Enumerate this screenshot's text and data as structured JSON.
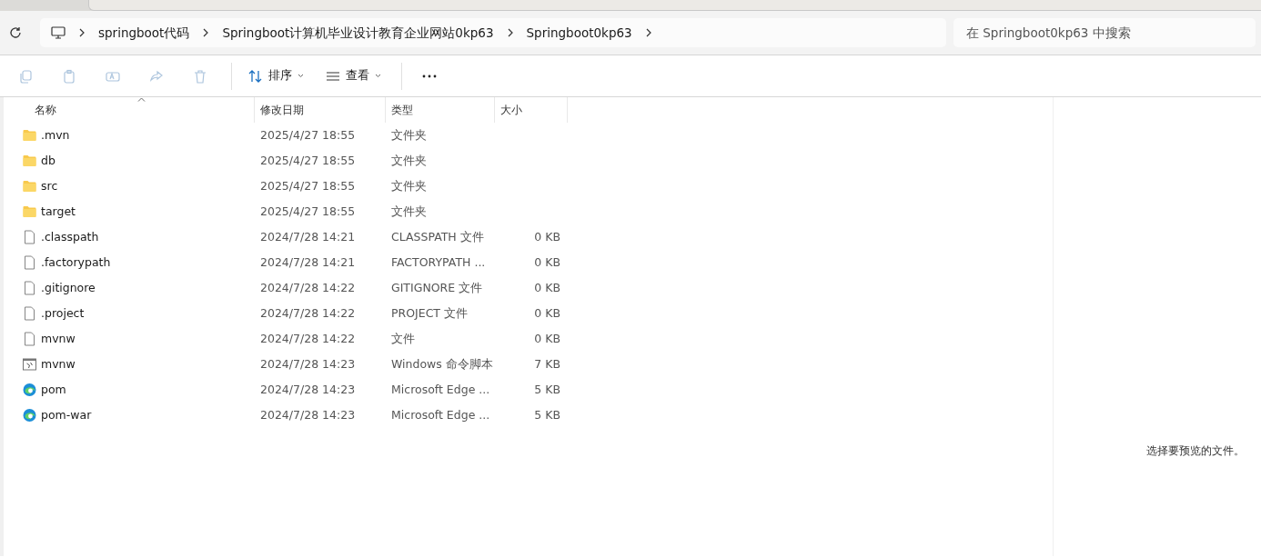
{
  "breadcrumb": [
    "springboot代码",
    "Springboot计算机毕业设计教育企业网站0kp63",
    "Springboot0kp63"
  ],
  "search": {
    "placeholder": "在 Springboot0kp63 中搜索"
  },
  "toolbar": [
    {
      "kind": "copy",
      "disabled": true
    },
    {
      "kind": "paste",
      "disabled": true
    },
    {
      "kind": "rename",
      "disabled": true
    },
    {
      "kind": "share",
      "disabled": true
    },
    {
      "kind": "delete",
      "disabled": true
    },
    {
      "kind": "sort",
      "label": "排序",
      "disabled": false
    },
    {
      "kind": "view",
      "label": "查看",
      "disabled": false
    },
    {
      "kind": "more",
      "disabled": false
    }
  ],
  "table": {
    "columns": [
      "名称",
      "修改日期",
      "类型",
      "大小"
    ],
    "rows": [
      {
        "kind": "folder",
        "name": ".mvn",
        "modified": "2025/4/27 18:55",
        "type": "文件夹"
      },
      {
        "kind": "folder",
        "name": "db",
        "modified": "2025/4/27 18:55",
        "type": "文件夹"
      },
      {
        "kind": "folder",
        "name": "src",
        "modified": "2025/4/27 18:55",
        "type": "文件夹"
      },
      {
        "kind": "folder",
        "name": "target",
        "modified": "2025/4/27 18:55",
        "type": "文件夹"
      },
      {
        "kind": "file",
        "name": ".classpath",
        "modified": "2024/7/28 14:21",
        "type": "CLASSPATH 文件",
        "size": "0 KB"
      },
      {
        "kind": "file",
        "name": ".factorypath",
        "modified": "2024/7/28 14:21",
        "type": "FACTORYPATH ...",
        "size": "0 KB"
      },
      {
        "kind": "file",
        "name": ".gitignore",
        "modified": "2024/7/28 14:22",
        "type": "GITIGNORE 文件",
        "size": "0 KB"
      },
      {
        "kind": "file",
        "name": ".project",
        "modified": "2024/7/28 14:22",
        "type": "PROJECT 文件",
        "size": "0 KB"
      },
      {
        "kind": "file",
        "name": "mvnw",
        "modified": "2024/7/28 14:22",
        "type": "文件",
        "size": "0 KB"
      },
      {
        "kind": "script",
        "name": "mvnw",
        "modified": "2024/7/28 14:23",
        "type": "Windows 命令脚本",
        "size": "7 KB"
      },
      {
        "kind": "edge",
        "name": "pom",
        "modified": "2024/7/28 14:23",
        "type": "Microsoft Edge ...",
        "size": "5 KB"
      },
      {
        "kind": "edge",
        "name": "pom-war",
        "modified": "2024/7/28 14:23",
        "type": "Microsoft Edge ...",
        "size": "5 KB"
      }
    ]
  },
  "preview": {
    "message": "选择要预览的文件。"
  }
}
